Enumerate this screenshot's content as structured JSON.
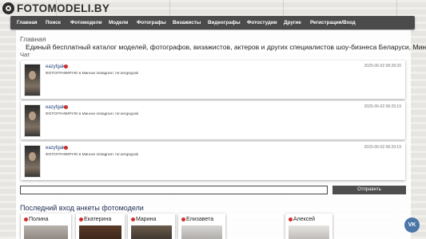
{
  "header": {
    "logo_text": "FOTOMODELI.BY"
  },
  "nav": {
    "items": [
      "Главная",
      "Поиск",
      "Фотомодели",
      "Модели",
      "Фотографы",
      "Визажисты",
      "Видеографы",
      "Фотостудии",
      "Другие",
      "Регистрация/Вход"
    ]
  },
  "breadcrumb": "Главная",
  "tagline": "Единый бесплатный каталог моделей, фотографов, визажистов, актеров и других специалистов шоу-бизнеса Беларуси, Минска.",
  "chat": {
    "title": "Чат",
    "messages": [
      {
        "user": "eazyfgak",
        "text": "ФОТОГРАФИРУЮ в Минске instagram: mr.sergeypak",
        "time": "2025-06-02 08:28:20"
      },
      {
        "user": "eazyfgak",
        "text": "ФОТОГРАФИРУЮ в Минске instagram: mr.sergeypak",
        "time": "2025-06-02 08:29:19"
      },
      {
        "user": "eazyfgak",
        "text": "ФОТОГРАФИРУЮ в Минске instagram: mr.sergeypak",
        "time": "2025-06-02 08:29:19"
      }
    ],
    "input_value": "",
    "send_label": "Отправить"
  },
  "recent": {
    "title": "Последний вход анкеты фотомодели",
    "models": [
      "Полина",
      "Екатерина",
      "Марина",
      "Елизавета",
      "Алексей"
    ]
  },
  "social": {
    "vk_label": "VK"
  },
  "colors": {
    "nav_bg": "#4b4b4b",
    "online_dot": "#d42a2a",
    "vk": "#4a76a8"
  }
}
